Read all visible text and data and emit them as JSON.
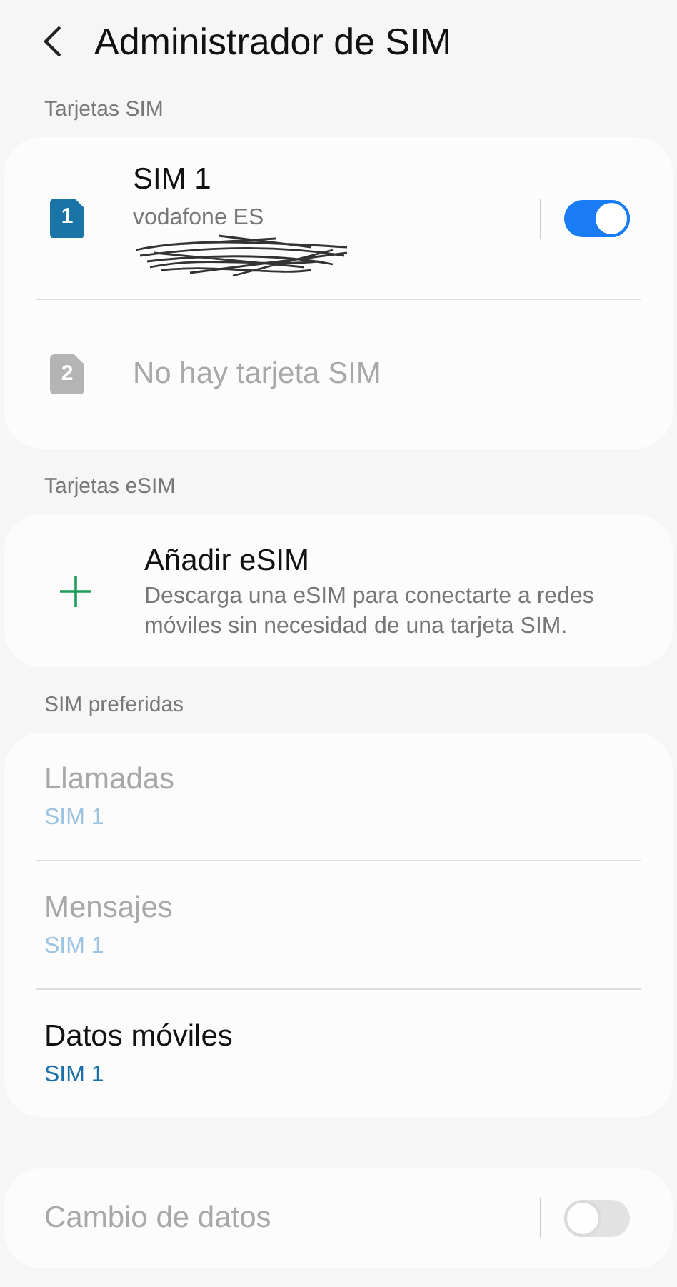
{
  "header": {
    "title": "Administrador de SIM"
  },
  "sim_cards": {
    "label": "Tarjetas SIM",
    "items": [
      {
        "slot": "1",
        "name": "SIM 1",
        "carrier": "vodafone ES",
        "number_scribbled": true,
        "disabled": false,
        "on": true
      },
      {
        "slot": "2",
        "name": "No hay tarjeta SIM",
        "disabled": true
      }
    ]
  },
  "esim": {
    "label": "Tarjetas eSIM",
    "title": "Añadir eSIM",
    "description": "Descarga una eSIM para conectarte a redes móviles sin necesidad de una tarjeta SIM."
  },
  "preferred": {
    "label": "SIM preferidas",
    "items": [
      {
        "title": "Llamadas",
        "value": "SIM 1",
        "disabled": true
      },
      {
        "title": "Mensajes",
        "value": "SIM 1",
        "disabled": true
      },
      {
        "title": "Datos móviles",
        "value": "SIM 1",
        "disabled": false
      }
    ]
  },
  "data_switch": {
    "title": "Cambio de datos",
    "disabled": true,
    "on": false
  }
}
